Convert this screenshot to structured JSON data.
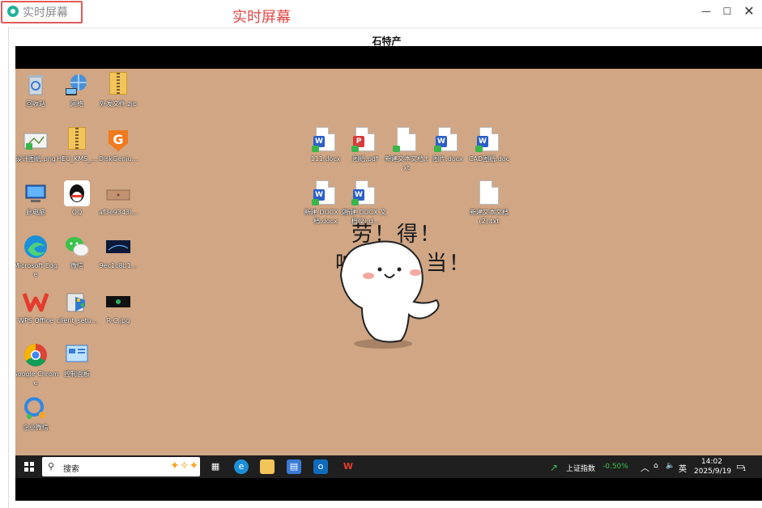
{
  "window": {
    "title": "实时屏幕",
    "annotation": "实时屏幕",
    "min_glyph": "—",
    "max_glyph": "☐",
    "close_glyph": "✕"
  },
  "viewer": {
    "title": "石特产"
  },
  "desktop": {
    "background_color": "#d0a684",
    "icons_left": [
      {
        "label": "回收站",
        "icon": "recycle-bin-icon"
      },
      {
        "label": "网络",
        "icon": "network-icon"
      },
      {
        "label": "外发文件.zip",
        "icon": "zip-folder-icon"
      },
      {
        "label": "设计图纸.png",
        "icon": "image-file-icon"
      },
      {
        "label": "HEU_KMS_...",
        "icon": "zip-folder-icon"
      },
      {
        "label": "DiskGeniu...",
        "icon": "diskgenius-icon"
      },
      {
        "label": "此电脑",
        "icon": "computer-icon"
      },
      {
        "label": "QQ",
        "icon": "qq-icon"
      },
      {
        "label": "af3e9343l...",
        "icon": "image-file-icon"
      },
      {
        "label": "Microsoft Edge",
        "icon": "edge-icon"
      },
      {
        "label": "微信",
        "icon": "wechat-icon"
      },
      {
        "label": "9ec1c8b1...",
        "icon": "image-file-icon"
      },
      {
        "label": "WPS Office",
        "icon": "wps-icon"
      },
      {
        "label": "client_setu...",
        "icon": "installer-icon"
      },
      {
        "label": "R-C.jpg",
        "icon": "image-file-icon"
      },
      {
        "label": "Google Chrome",
        "icon": "chrome-icon"
      },
      {
        "label": "控制面板",
        "icon": "control-panel-icon"
      },
      {
        "label": "企业微信",
        "icon": "wecom-icon"
      }
    ],
    "icons_right": [
      {
        "label": "111.docx",
        "badge": "W"
      },
      {
        "label": "图纸.pdf",
        "badge": "P"
      },
      {
        "label": "新建文本文档.txt",
        "badge": ""
      },
      {
        "label": "图片.docx",
        "badge": "W"
      },
      {
        "label": "CAD图纸.doc",
        "badge": "W"
      },
      {
        "label": "新建 DOCX 文档.docx",
        "badge": "W"
      },
      {
        "label": "新建 DOCX 文档(2).d...",
        "badge": "W"
      },
      {
        "label": "新建文本文档 (2).txt",
        "badge": ""
      }
    ],
    "wallpaper_text_1": "劳！得！",
    "wallpaper_text_2": "响！叮！当！"
  },
  "taskbar": {
    "search_placeholder": "搜索",
    "stock_name": "上证指数",
    "stock_change": "-0.50%",
    "input_method": "英",
    "time": "14:02",
    "date": "2025/9/19",
    "notification_count": "1",
    "colors": {
      "negative": "#3cc24b"
    }
  }
}
